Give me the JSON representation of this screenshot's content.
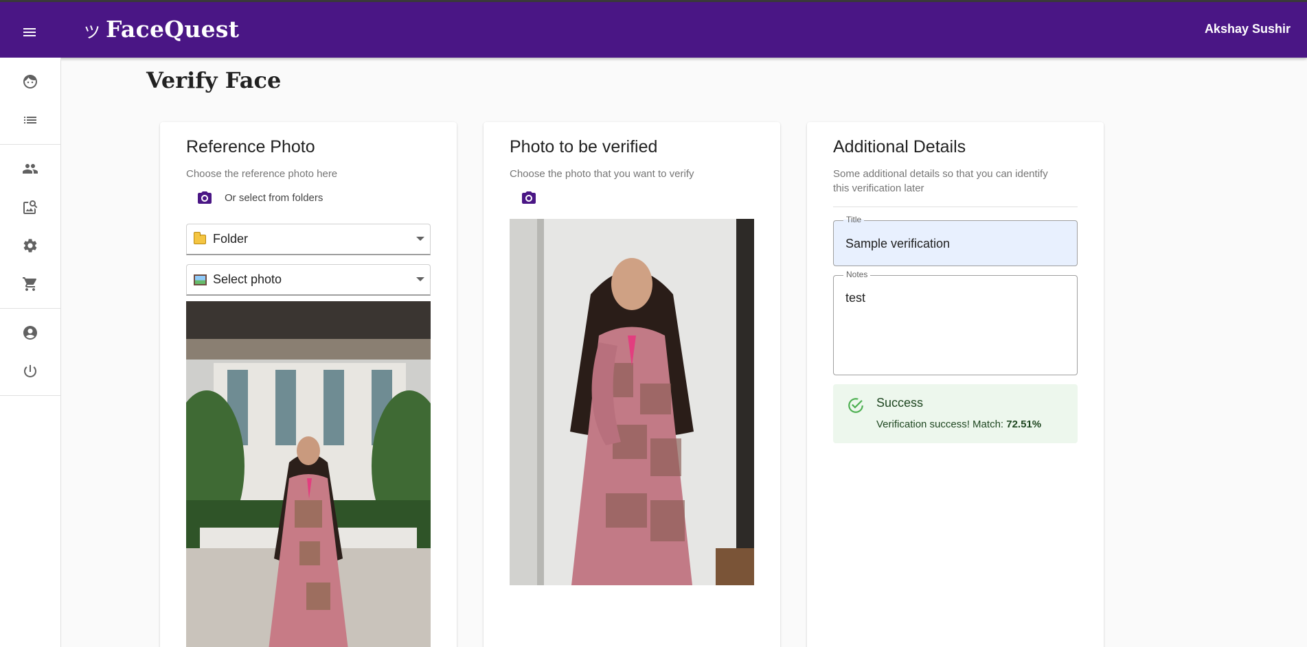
{
  "app": {
    "name": "FaceQuest",
    "logo_glyph": "ツ",
    "user_name": "Akshay Sushir",
    "brand_color": "#4a1685"
  },
  "sidebar": {
    "groups": [
      {
        "items": [
          {
            "icon": "face-icon",
            "label": "Verify Face"
          },
          {
            "icon": "list-icon",
            "label": "Verifications"
          }
        ]
      },
      {
        "items": [
          {
            "icon": "people-icon",
            "label": "People"
          },
          {
            "icon": "image-search-icon",
            "label": "Photos"
          },
          {
            "icon": "gear-icon",
            "label": "Settings"
          },
          {
            "icon": "cart-icon",
            "label": "Shop"
          }
        ]
      },
      {
        "items": [
          {
            "icon": "account-icon",
            "label": "Account"
          },
          {
            "icon": "power-icon",
            "label": "Logout"
          }
        ]
      }
    ]
  },
  "page": {
    "title": "Verify Face"
  },
  "reference": {
    "title": "Reference Photo",
    "subtitle": "Choose the reference photo here",
    "folder_link": "Or select from folders",
    "folder_select": {
      "icon": "folder-icon",
      "value": "Folder"
    },
    "photo_select": {
      "icon": "picture-icon",
      "value": "Select photo"
    }
  },
  "verify": {
    "title": "Photo to be verified",
    "subtitle": "Choose the photo that you want to verify"
  },
  "details": {
    "title": "Additional Details",
    "subtitle": "Some additional details so that you can identify this verification later",
    "title_field": {
      "label": "Title",
      "value": "Sample verification"
    },
    "notes_field": {
      "label": "Notes",
      "value": "test"
    },
    "alert": {
      "status_color": "#4caf50",
      "title": "Success",
      "message_prefix": "Verification success! Match: ",
      "match_value": "72.51%"
    }
  }
}
